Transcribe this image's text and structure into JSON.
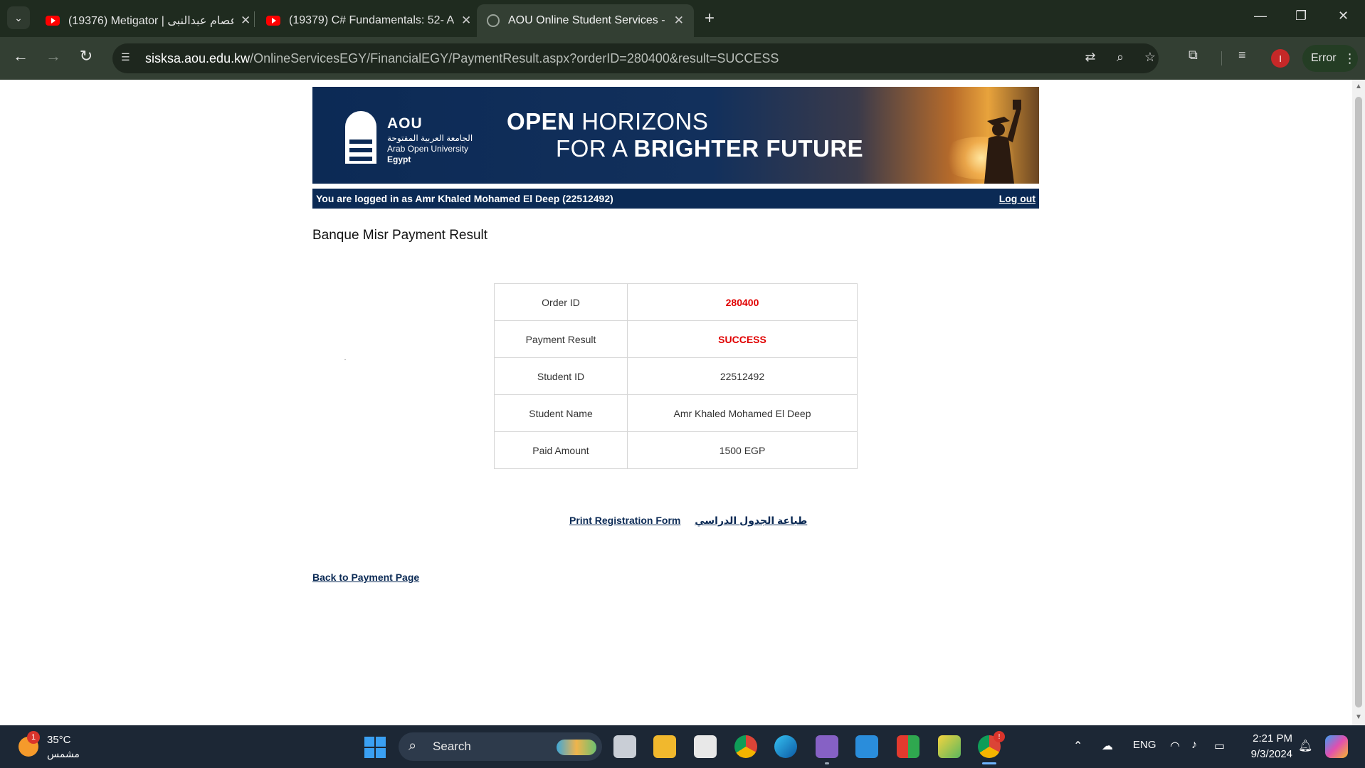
{
  "browser": {
    "tabs": [
      {
        "title": "(19376) Metigator | عصام عبدالنبى",
        "favicon": "youtube-icon",
        "active": false
      },
      {
        "title": "(19379) C# Fundamentals: 52- A",
        "favicon": "youtube-icon",
        "active": false
      },
      {
        "title": "AOU Online Student Services - F",
        "favicon": "globe-icon",
        "active": true
      }
    ],
    "url_host": "sisksa.aou.edu.kw",
    "url_rest": "/OnlineServicesEGY/FinancialEGY/PaymentResult.aspx?orderID=280400&result=SUCCESS",
    "profile_initial": "I",
    "error_label": "Error"
  },
  "banner": {
    "logo_abbr": "AOU",
    "logo_arabic": "الجامعة العربية المفتوحة",
    "logo_english": "Arab Open University",
    "logo_country": "Egypt",
    "tagline_1_bold": "OPEN",
    "tagline_1_rest": " HORIZONS",
    "tagline_2_rest": "FOR A ",
    "tagline_2_bold": "BRIGHTER FUTURE"
  },
  "login": {
    "status": "You are logged in as Amr Khaled Mohamed El Deep (22512492)",
    "logout_label": "Log out"
  },
  "page": {
    "heading": "Banque Misr Payment Result"
  },
  "result_rows": [
    {
      "label": "Order ID",
      "value": "280400"
    },
    {
      "label": "Payment Result",
      "value": "SUCCESS"
    },
    {
      "label": "Student ID",
      "value": "22512492"
    },
    {
      "label": "Student Name",
      "value": "Amr Khaled Mohamed El Deep"
    },
    {
      "label": "Paid Amount",
      "value": "1500 EGP"
    }
  ],
  "links": {
    "print_registration": "Print Registration Form",
    "print_schedule_ar": "طباعة الجدول الدراسي",
    "back_to_payment": "Back to Payment Page"
  },
  "taskbar": {
    "weather_temp": "35°C",
    "weather_desc": "مشمس",
    "weather_badge": "1",
    "search_label": "Search",
    "language": "ENG",
    "time": "2:21 PM",
    "date": "9/3/2024",
    "chrome_badge": "!"
  },
  "colors": {
    "brand_navy": "#0b2a55",
    "highlight_red": "#e00000"
  }
}
